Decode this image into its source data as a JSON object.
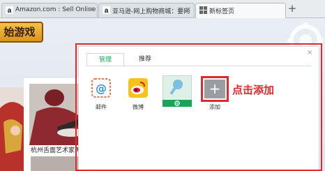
{
  "browser": {
    "tabs": [
      {
        "title": "Amazon.com : Sell Online -",
        "favicon": "amazon-a-icon"
      },
      {
        "title": "亚马逊-网上购物商城：要网",
        "favicon": "amazon-a-icon"
      },
      {
        "title": "新标签页",
        "favicon": "new-tab-grid-icon"
      }
    ],
    "new_tab_symbol": "+"
  },
  "page": {
    "game_button": "始游戏",
    "card_caption": "杭州舌面艺术家再"
  },
  "dialog": {
    "tabs": [
      "管理",
      "推荐"
    ],
    "close_symbol": "×",
    "tiles": [
      {
        "label": "邮件",
        "icon": "mail-icon"
      },
      {
        "label": "微博",
        "icon": "weibo-icon"
      },
      {
        "label": "",
        "icon": "key-icon",
        "footer_icon": "gear-icon"
      },
      {
        "label": "添加",
        "icon": "plus-icon",
        "symbol": "+"
      }
    ],
    "annotation": "点击添加"
  },
  "colors": {
    "accent_green": "#18a558",
    "annotation_red": "#e0282d"
  }
}
